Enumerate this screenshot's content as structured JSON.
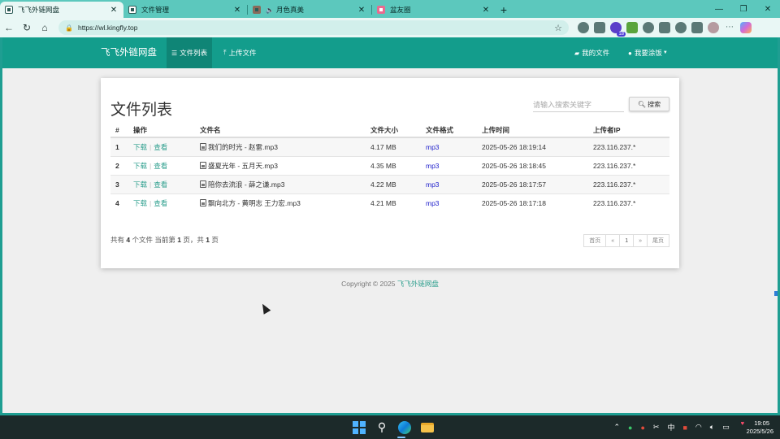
{
  "browser": {
    "tabs": [
      {
        "label": "飞飞外链网盘",
        "active": true
      },
      {
        "label": "文件管理",
        "active": false
      },
      {
        "label": "月色真美",
        "active": false
      },
      {
        "label": "盆友圈",
        "active": false
      }
    ],
    "url": "https://wl.kingfly.top",
    "extension_badge": "18"
  },
  "nav": {
    "brand": "飞飞外链网盘",
    "links": [
      {
        "label": "文件列表",
        "icon": "list-icon",
        "active": true
      },
      {
        "label": "上传文件",
        "icon": "upload-icon",
        "active": false
      }
    ],
    "right": [
      {
        "label": "我的文件",
        "icon": "folder-icon"
      },
      {
        "label": "我要涂饭",
        "icon": "wechat-icon"
      }
    ]
  },
  "panel": {
    "title": "文件列表",
    "search_placeholder": "请输入搜索关键字",
    "search_button": "搜索"
  },
  "table": {
    "headers": [
      "#",
      "操作",
      "文件名",
      "文件大小",
      "文件格式",
      "上传时间",
      "上传者IP"
    ],
    "action_download": "下载",
    "action_separator": "|",
    "action_view": "查看",
    "rows": [
      {
        "idx": "1",
        "name": "我们的时光 - 赵雷.mp3",
        "size": "4.17 MB",
        "format": "mp3",
        "time": "2025-05-26 18:19:14",
        "ip": "223.116.237.*"
      },
      {
        "idx": "2",
        "name": "盛夏光年 - 五月天.mp3",
        "size": "4.35 MB",
        "format": "mp3",
        "time": "2025-05-26 18:18:45",
        "ip": "223.116.237.*"
      },
      {
        "idx": "3",
        "name": "陪你去流浪 - 薛之谦.mp3",
        "size": "4.22 MB",
        "format": "mp3",
        "time": "2025-05-26 18:17:57",
        "ip": "223.116.237.*"
      },
      {
        "idx": "4",
        "name": "飘向北方 - 黄明志 王力宏.mp3",
        "size": "4.21 MB",
        "format": "mp3",
        "time": "2025-05-26 18:17:18",
        "ip": "223.116.237.*"
      }
    ]
  },
  "pager": {
    "info_prefix": "共有",
    "total": "4",
    "info_mid": "个文件  当前第",
    "current": "1",
    "info_mid2": "页，共",
    "pages": "1",
    "info_suffix": "页",
    "buttons": [
      "首页",
      "«",
      "1",
      "»",
      "尾页"
    ]
  },
  "footer": {
    "copyright": "Copyright © 2025",
    "site": "飞飞外链网盘"
  },
  "taskbar": {
    "time": "19:05",
    "date": "2025/5/26",
    "ime": "中"
  }
}
